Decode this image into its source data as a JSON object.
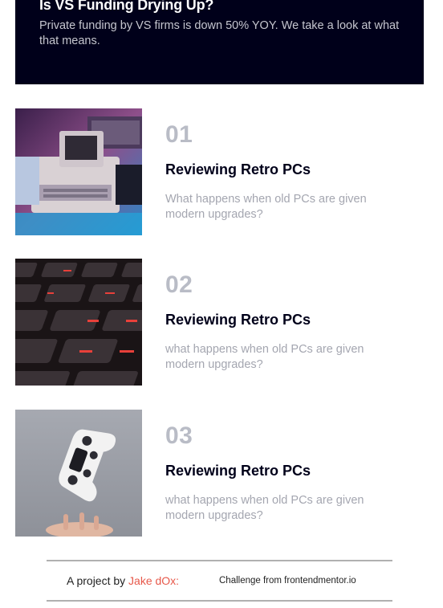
{
  "new_card": {
    "title": "Is VS Funding Drying Up?",
    "description": "Private funding by VS firms is down 50% YOY. We take a look at what that means."
  },
  "articles": [
    {
      "number": "01",
      "title": "Reviewing Retro PCs",
      "description": "What happens when old PCs are given modern upgrades?",
      "image_icon": "retro-pc-image"
    },
    {
      "number": "02",
      "title": "Reviewing Retro PCs",
      "description": "what happens when old PCs are given modern upgrades?",
      "image_icon": "keyboard-image"
    },
    {
      "number": "03",
      "title": "Reviewing Retro PCs",
      "description": "what happens when old PCs are given modern upgrades?",
      "image_icon": "gamepad-image"
    }
  ],
  "footer": {
    "project_prefix": "A project by",
    "author": "Jake dOx:",
    "challenge": "Challenge from frontendmentor.io"
  },
  "colors": {
    "dark_navy": "#00001a",
    "number_gray": "#b9bcc6",
    "text_gray": "#a4a6b0",
    "author_red": "#e7584a"
  }
}
